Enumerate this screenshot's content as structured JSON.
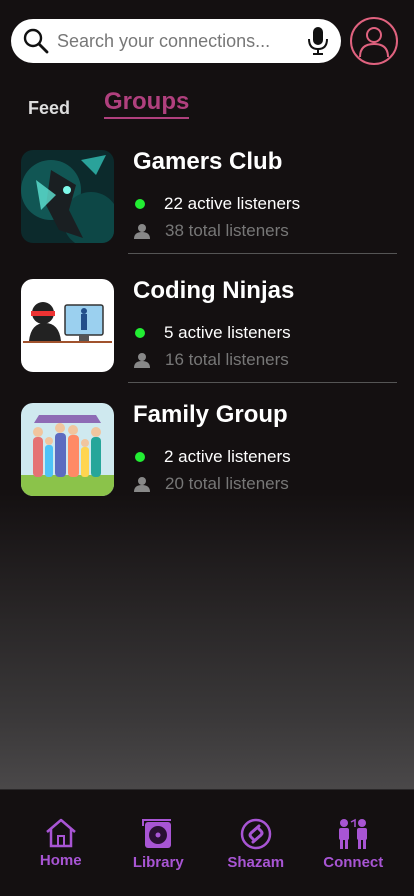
{
  "search": {
    "placeholder": "Search your connections..."
  },
  "tabs": {
    "feed": "Feed",
    "groups": "Groups"
  },
  "groups": [
    {
      "name": "Gamers Club",
      "active": "22 active listeners",
      "total": "38 total listeners"
    },
    {
      "name": "Coding Ninjas",
      "active": "5 active listeners",
      "total": "16 total listeners"
    },
    {
      "name": "Family Group",
      "active": "2 active listeners",
      "total": "20 total listeners"
    }
  ],
  "nav": {
    "home": "Home",
    "library": "Library",
    "shazam": "Shazam",
    "connect": "Connect"
  },
  "colors": {
    "accent": "#b0407e",
    "nav": "#a855d4",
    "online": "#22ee33",
    "avatar_ring": "#e0627f"
  }
}
